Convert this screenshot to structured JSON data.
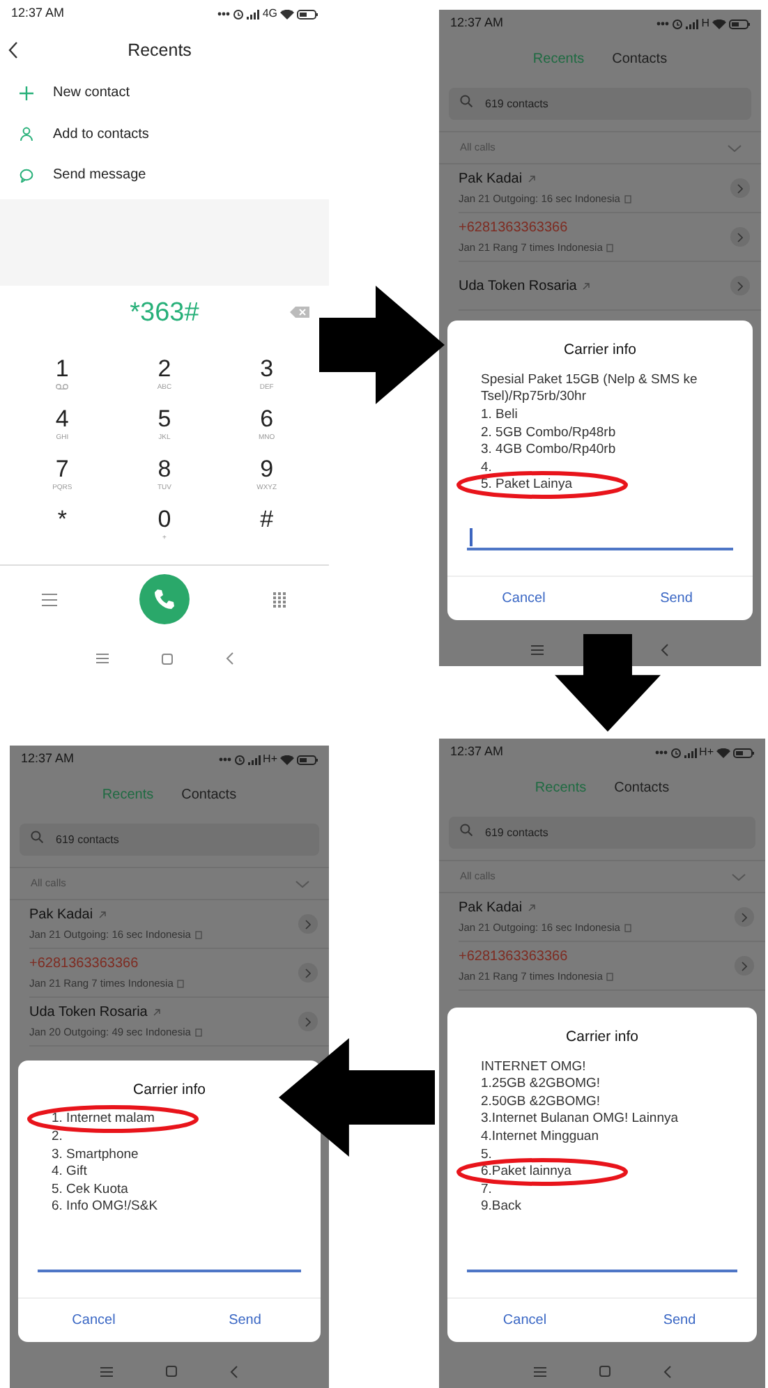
{
  "panels": [
    {
      "kind": "dialer",
      "status": {
        "time": "12:37 AM",
        "network": "4G"
      },
      "title": "Recents",
      "actions": [
        {
          "label": "New contact"
        },
        {
          "label": "Add to contacts"
        },
        {
          "label": "Send message"
        }
      ],
      "number": "*363#",
      "keys": [
        {
          "digit": "1"
        },
        {
          "digit": "2",
          "letters": "ABC"
        },
        {
          "digit": "3",
          "letters": "DEF"
        },
        {
          "digit": "4",
          "letters": "GHI"
        },
        {
          "digit": "5",
          "letters": "JKL"
        },
        {
          "digit": "6",
          "letters": "MNO"
        },
        {
          "digit": "7",
          "letters": "PQRS"
        },
        {
          "digit": "8",
          "letters": "TUV"
        },
        {
          "digit": "9",
          "letters": "WXYZ"
        },
        {
          "digit": "*"
        },
        {
          "digit": "0",
          "letters": "+"
        },
        {
          "digit": "#"
        }
      ]
    },
    {
      "kind": "call-log",
      "status": {
        "time": "12:37 AM",
        "network": "H"
      },
      "tabs": [
        {
          "label": "Recents",
          "selected": true
        },
        {
          "label": "Contacts",
          "selected": false
        }
      ],
      "search": {
        "placeholder": "619 contacts"
      },
      "filter": "All calls",
      "calls": [
        {
          "name": "Pak Kadai",
          "missed": false,
          "detail": "Jan 21 Outgoing: 16 sec Indonesia"
        },
        {
          "name": "+6281363363366",
          "missed": true,
          "detail": "Jan 21 Rang 7 times Indonesia"
        },
        {
          "name": "Uda Token Rosaria",
          "missed": false
        }
      ],
      "dialog": {
        "title": "Carrier info",
        "lines": [
          {
            "text": "Spesial Paket 15GB (Nelp & SMS ke Tsel)/Rp75rb/30hr",
            "circled": false
          },
          {
            "text": "1. Beli",
            "circled": false
          },
          {
            "text": "2. 5GB Combo/Rp48rb",
            "circled": false
          },
          {
            "text": "3. 4GB Combo/Rp40rb",
            "circled": false
          },
          {
            "text": "4.",
            "circled": false
          },
          {
            "text": "5. Paket Lainya",
            "circled": true
          }
        ],
        "focused": true,
        "buttons": [
          "Cancel",
          "Send"
        ]
      }
    },
    {
      "kind": "call-log",
      "status": {
        "time": "12:37 AM",
        "network": "H+"
      },
      "tabs": [
        {
          "label": "Recents",
          "selected": true
        },
        {
          "label": "Contacts",
          "selected": false
        }
      ],
      "search": {
        "placeholder": "619 contacts"
      },
      "filter": "All calls",
      "calls": [
        {
          "name": "Pak Kadai",
          "missed": false,
          "detail": "Jan 21 Outgoing: 16 sec Indonesia"
        },
        {
          "name": "+6281363363366",
          "missed": true,
          "detail": "Jan 21 Rang 7 times Indonesia"
        },
        {
          "name": "Uda Token Rosaria",
          "missed": false,
          "detail": "Jan 20 Outgoing: 49 sec Indonesia"
        }
      ],
      "dialog": {
        "title": "Carrier info",
        "lines": [
          {
            "text": "1. Internet malam",
            "circled": true
          },
          {
            "text": "2.",
            "circled": false
          },
          {
            "text": "3. Smartphone",
            "circled": false
          },
          {
            "text": "4. Gift",
            "circled": false
          },
          {
            "text": "5. Cek Kuota",
            "circled": false
          },
          {
            "text": "6. Info OMG!/S&K",
            "circled": false
          }
        ],
        "focused": false,
        "buttons": [
          "Cancel",
          "Send"
        ]
      }
    },
    {
      "kind": "call-log",
      "status": {
        "time": "12:37 AM",
        "network": "H+"
      },
      "tabs": [
        {
          "label": "Recents",
          "selected": true
        },
        {
          "label": "Contacts",
          "selected": false
        }
      ],
      "search": {
        "placeholder": "619 contacts"
      },
      "filter": "All calls",
      "calls": [
        {
          "name": "Pak Kadai",
          "missed": false,
          "detail": "Jan 21 Outgoing: 16 sec Indonesia"
        },
        {
          "name": "+6281363363366",
          "missed": true,
          "detail": "Jan 21 Rang 7 times Indonesia"
        }
      ],
      "dialog": {
        "title": "Carrier info",
        "lines": [
          {
            "text": "INTERNET OMG!",
            "circled": false
          },
          {
            "text": "1.25GB &2GBOMG!",
            "circled": false
          },
          {
            "text": "2.50GB &2GBOMG!",
            "circled": false
          },
          {
            "text": "3.Internet Bulanan OMG! Lainnya",
            "circled": false
          },
          {
            "text": "4.Internet Mingguan",
            "circled": false
          },
          {
            "text": "5.",
            "circled": false
          },
          {
            "text": "6.Paket lainnya",
            "circled": true
          },
          {
            "text": "7.",
            "circled": false
          },
          {
            "text": "9.Back",
            "circled": false
          }
        ],
        "focused": false,
        "buttons": [
          "Cancel",
          "Send"
        ]
      }
    }
  ],
  "arrows": [
    {
      "kind": "right"
    },
    {
      "kind": "down"
    },
    {
      "kind": "left"
    }
  ]
}
